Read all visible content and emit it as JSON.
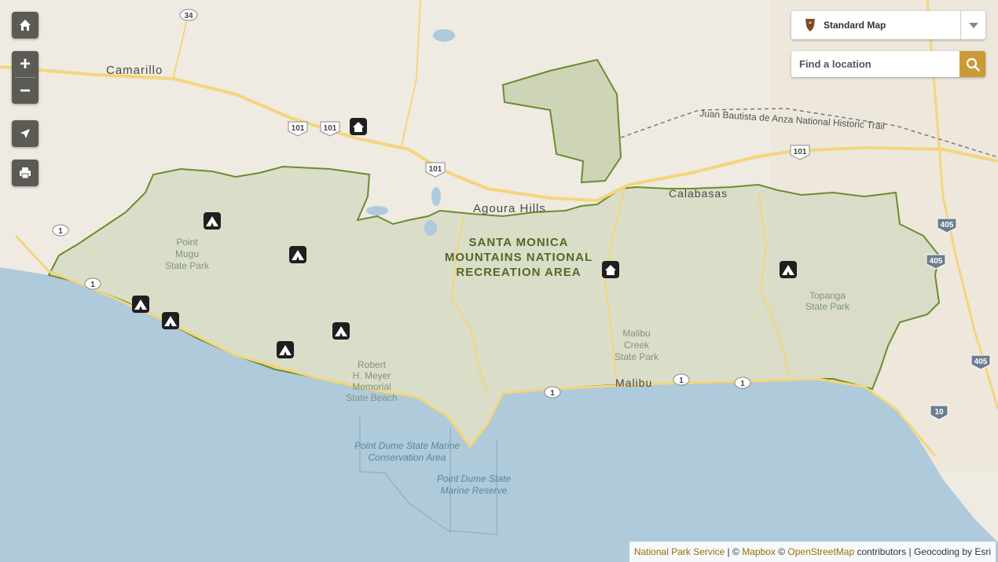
{
  "basemap": {
    "selected_label": "Standard Map",
    "icon": "nps-arrowhead-icon",
    "caret_icon": "chevron-down-icon"
  },
  "search": {
    "placeholder": "Find a location",
    "button_icon": "search-icon"
  },
  "controls": {
    "home_icon": "home-icon",
    "zoom_in_label": "+",
    "zoom_out_label": "−",
    "locate_icon": "location-arrow-icon",
    "print_icon": "printer-icon"
  },
  "attribution": {
    "nps": "National Park Service",
    "sep1": " | © ",
    "mapbox": "Mapbox",
    "sep2": " © ",
    "osm": "OpenStreetMap",
    "rest": " contributors | Geocoding by Esri"
  },
  "map": {
    "park_label_lines": [
      "SANTA MONICA",
      "MOUNTAINS NATIONAL",
      "RECREATION AREA"
    ],
    "cities": {
      "camarillo": "Camarillo",
      "agoura_hills": "Agoura Hills",
      "calabasas": "Calabasas",
      "malibu": "Malibu"
    },
    "parks": {
      "point_mugu": [
        "Point",
        "Mugu",
        "State Park"
      ],
      "malibu_creek": [
        "Malibu",
        "Creek",
        "State Park"
      ],
      "topanga": [
        "Topanga",
        "State Park"
      ],
      "robert_meyer": [
        "Robert",
        "H. Meyer",
        "Memorial",
        "State Beach"
      ]
    },
    "marine": {
      "conservation": [
        "Point Dume State Marine",
        "Conservation Area"
      ],
      "reserve": [
        "Point Dume State",
        "Marine Reserve"
      ]
    },
    "trail": "Juan Bautista de Anza National Historic Trail",
    "route_shields": {
      "r34": "34",
      "r101": "101",
      "r1": "1",
      "r405": "405",
      "r10": "10"
    },
    "colors": {
      "water": "#aecadb",
      "land": "#efeae2",
      "park_fill": "#d4d9c2",
      "park_border": "#6b8c2e",
      "accent": "#c99a35",
      "control_bg": "#5b5a55"
    }
  }
}
